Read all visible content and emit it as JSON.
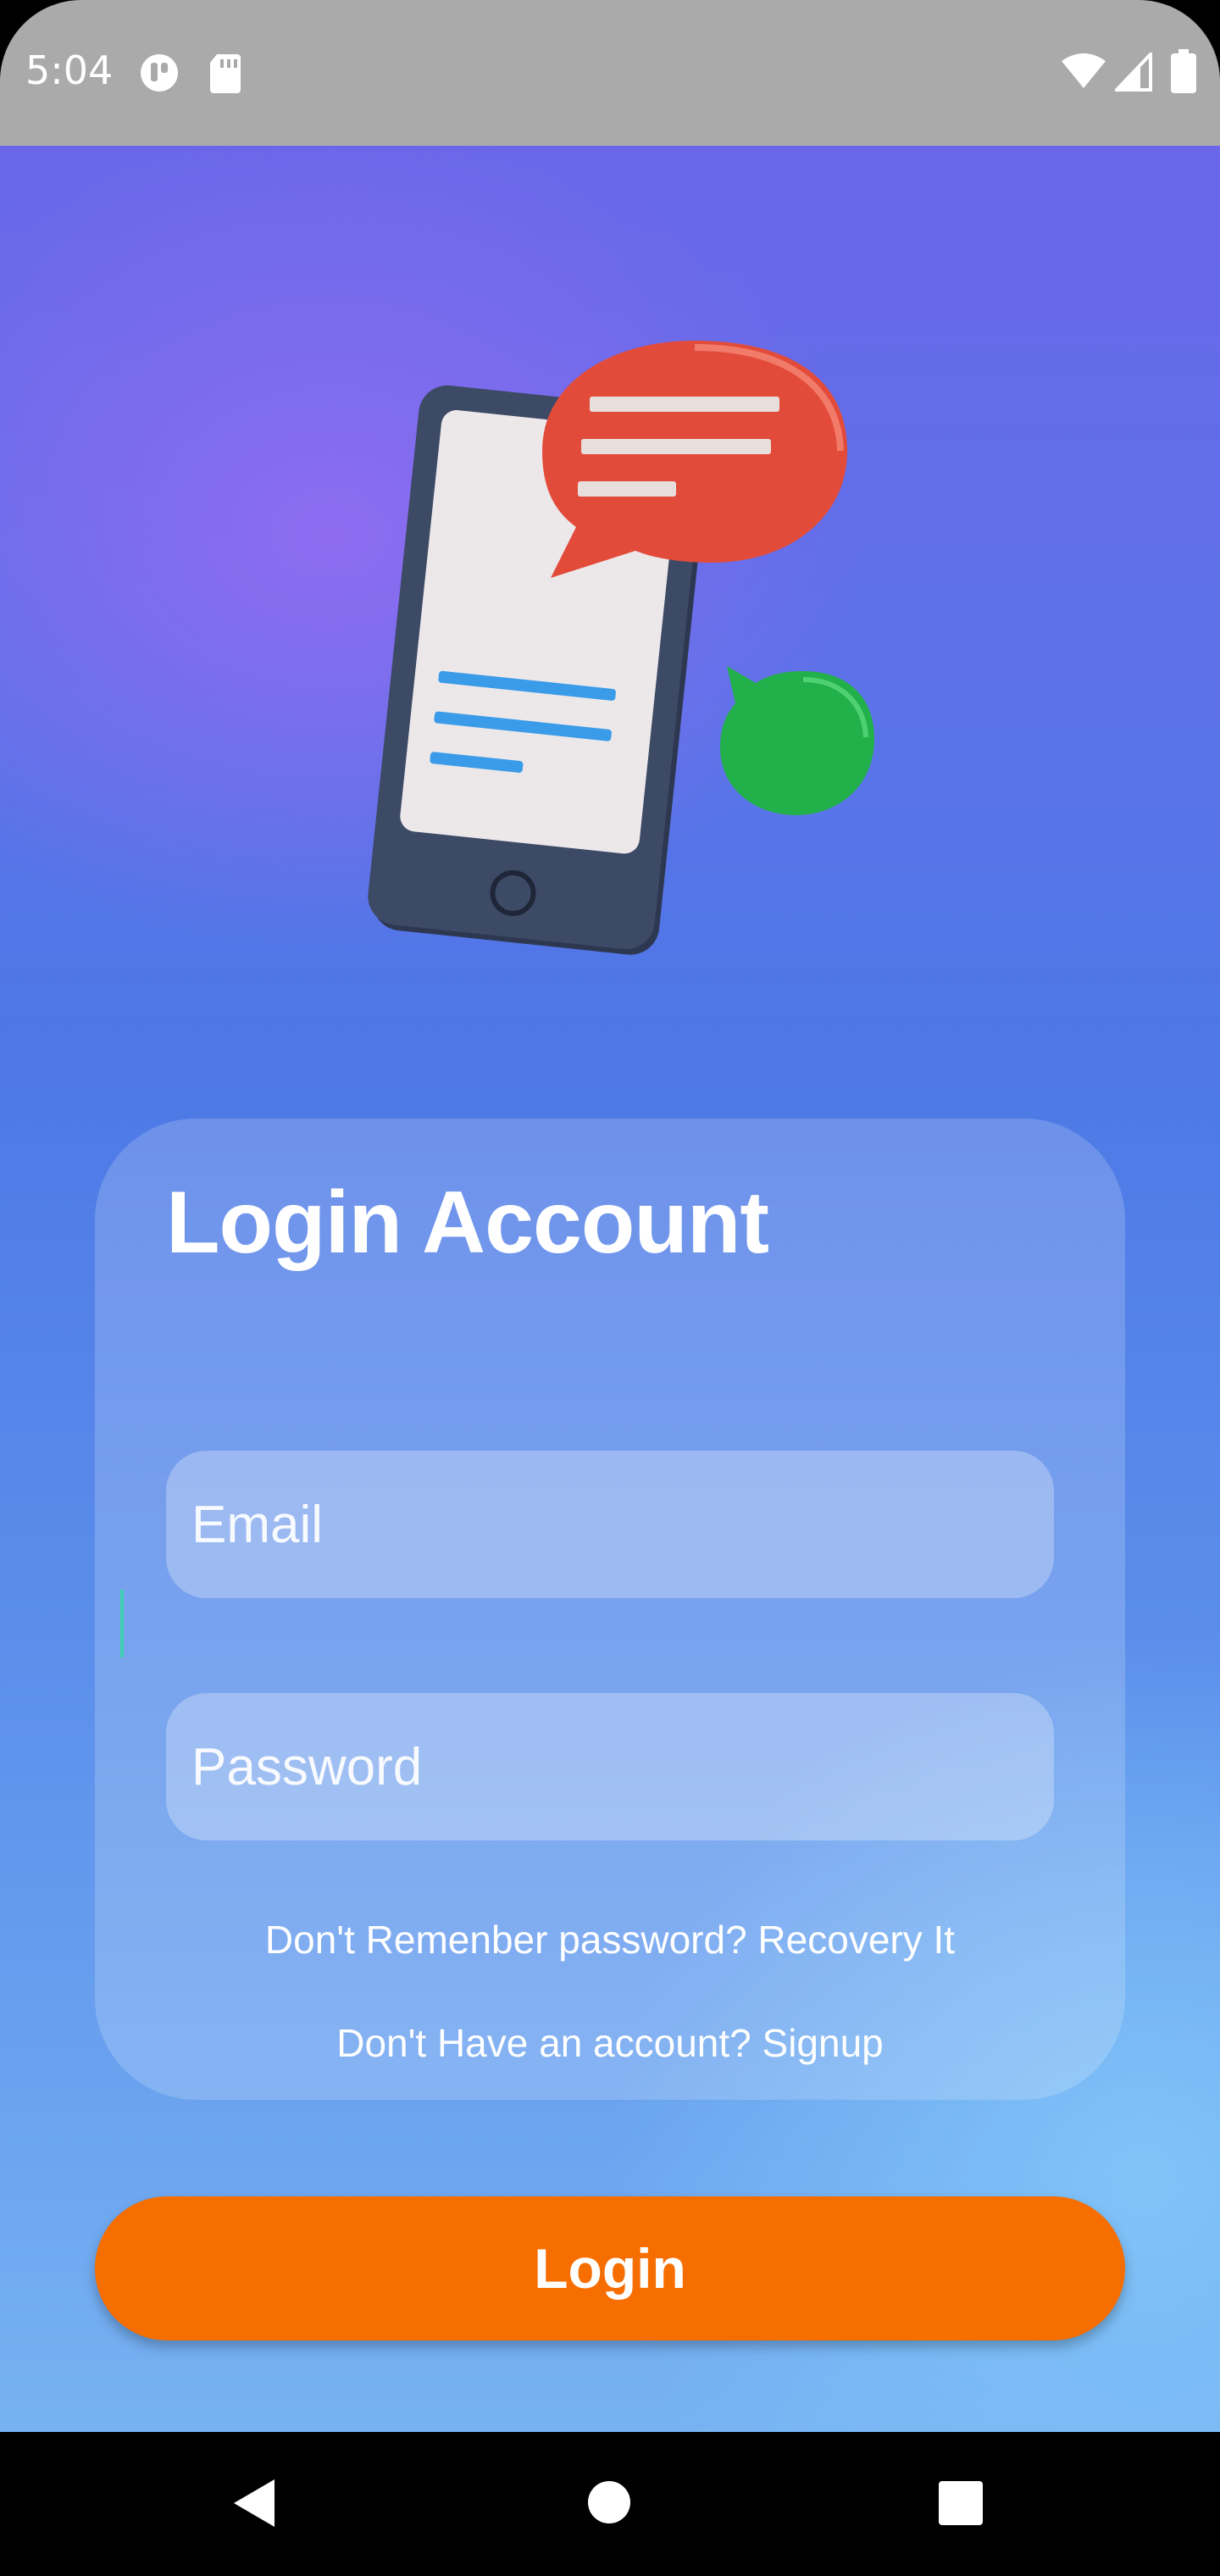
{
  "status_bar": {
    "time": "5:04",
    "icons": [
      "app-notification-icon",
      "sd-card-icon",
      "wifi-icon",
      "cell-signal-icon",
      "battery-icon"
    ]
  },
  "illustration": {
    "icon": "phone-chat-illustration",
    "colors": {
      "phone": "#3d4a66",
      "screen": "#ece8ea",
      "red_bubble": "#e24b3a",
      "green_bubble": "#22b04a",
      "blue_lines": "#3a9be8"
    }
  },
  "login": {
    "title": "Login Account",
    "email_placeholder": "Email",
    "password_placeholder": "Password",
    "recovery_text": "Don't Remenber password? Recovery It",
    "signup_text": "Don't Have an account? Signup",
    "button_label": "Login"
  },
  "colors": {
    "status_bar": "#aaaaaa",
    "button": "#f76e00",
    "gradient_top": "#6a67ea",
    "gradient_bottom": "#77b2f2"
  },
  "nav_bar": {
    "icons": [
      "back-icon",
      "home-icon",
      "recents-icon"
    ]
  }
}
